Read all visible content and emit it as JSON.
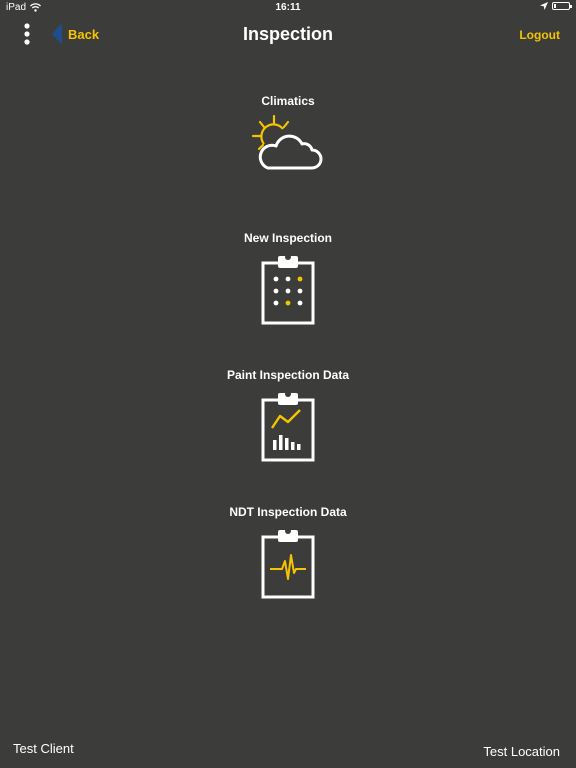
{
  "status_bar": {
    "device": "iPad",
    "time": "16:11",
    "icons": [
      "wifi-icon",
      "location-arrow-icon",
      "battery-icon"
    ]
  },
  "nav": {
    "menu_icon": "vertical-dots-icon",
    "back_label": "Back",
    "title": "Inspection",
    "logout_label": "Logout"
  },
  "tiles": [
    {
      "label": "Climatics",
      "icon": "sun-cloud-icon"
    },
    {
      "label": "New Inspection",
      "icon": "clipboard-dots-icon"
    },
    {
      "label": "Paint Inspection Data",
      "icon": "clipboard-chart-icon"
    },
    {
      "label": "NDT Inspection Data",
      "icon": "clipboard-pulse-icon"
    }
  ],
  "footer": {
    "client": "Test Client",
    "location": "Test Location"
  },
  "colors": {
    "background": "#3c3c3b",
    "accent": "#f5c400",
    "text": "#ffffff"
  }
}
